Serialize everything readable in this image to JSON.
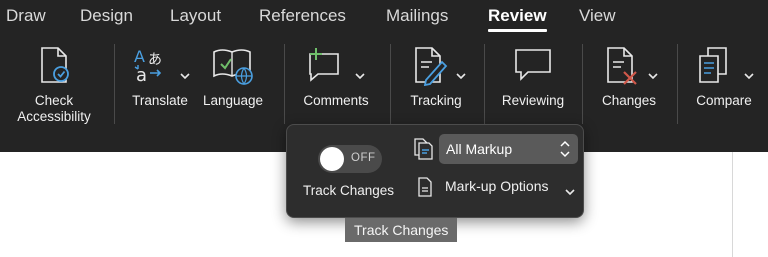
{
  "tabs": [
    {
      "label": "Draw"
    },
    {
      "label": "Design"
    },
    {
      "label": "Layout"
    },
    {
      "label": "References"
    },
    {
      "label": "Mailings"
    },
    {
      "label": "Review"
    },
    {
      "label": "View"
    }
  ],
  "active_tab": "Review",
  "toolbar": {
    "check_accessibility_line1": "Check",
    "check_accessibility_line2": "Accessibility",
    "translate": "Translate",
    "language": "Language",
    "comments": "Comments",
    "tracking": "Tracking",
    "reviewing": "Reviewing",
    "changes": "Changes",
    "compare": "Compare"
  },
  "tracking_popup": {
    "toggle_state": "OFF",
    "track_changes_label": "Track Changes",
    "markup_select_value": "All Markup",
    "markup_options_label": "Mark-up Options"
  },
  "tooltip": {
    "text": "Track Changes"
  },
  "colors": {
    "ribbon_bg": "#242424",
    "popup_bg": "#2d2d2d",
    "accent_green": "#6fbf6a",
    "accent_blue": "#4a9fe0"
  }
}
